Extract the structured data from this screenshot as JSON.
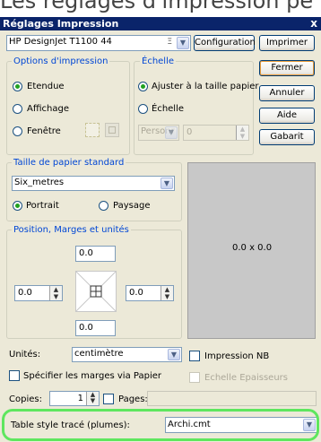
{
  "caption": "Les réglages d'impression pe",
  "window": {
    "title": "Réglages Impression",
    "close": "x"
  },
  "printer": {
    "name": "HP DesignJet T1100 44",
    "dropdown_hint": "Ξ"
  },
  "buttons": {
    "configuration": "Configuration",
    "imprimer": "Imprimer",
    "fermer": "Fermer",
    "annuler": "Annuler",
    "aide": "Aide",
    "gabarit": "Gabarit"
  },
  "options_impression": {
    "legend": "Options d'impression",
    "etendue": "Etendue",
    "affichage": "Affichage",
    "fenetre": "Fenêtre"
  },
  "echelle": {
    "legend": "Échelle",
    "ajuster": "Ajuster à la taille papier",
    "echelle": "Échelle",
    "custom_select": "Personr",
    "custom_value": "0"
  },
  "papier": {
    "legend": "Taille de papier standard",
    "size": "Six_metres",
    "portrait": "Portrait",
    "paysage": "Paysage"
  },
  "marges": {
    "legend": "Position, Marges et unités",
    "top": "0.0",
    "left": "0.0",
    "right": "0.0",
    "bottom": "0.0"
  },
  "preview": {
    "size_label": "0.0 x 0.0"
  },
  "unites": {
    "label": "Unités:",
    "value": "centimètre"
  },
  "impression_nb": "Impression NB",
  "echelle_epaisseurs": "Echelle Epaisseurs",
  "specifier_marges": "Spécifier les marges via Papier",
  "copies": {
    "label": "Copies:",
    "value": "1"
  },
  "pages": {
    "label": "Pages:",
    "value": ""
  },
  "table_style": {
    "label": "Table style tracé (plumes):",
    "value": "Archi.cmt"
  },
  "colors": {
    "title_bar": "#0a246a",
    "dialog_bg": "#ece9d8",
    "legend": "#0046d5",
    "highlight": "#5ee65e"
  }
}
